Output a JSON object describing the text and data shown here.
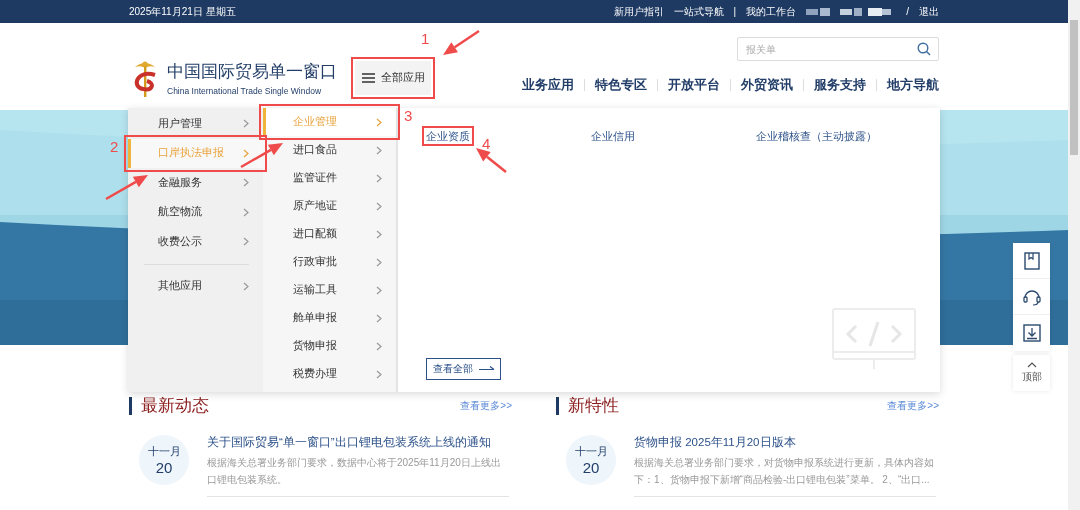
{
  "top_bar": {
    "date": "2025年11月21日 星期五",
    "links": [
      {
        "kind": "link",
        "text": "新用户指引"
      },
      {
        "kind": "link",
        "text": "一站式导航"
      },
      {
        "kind": "separator",
        "text": "|"
      },
      {
        "kind": "link",
        "text": "我的工作台"
      },
      {
        "kind": "masked"
      },
      {
        "kind": "separator",
        "text": "/"
      },
      {
        "kind": "link",
        "text": "退出"
      }
    ]
  },
  "header": {
    "logo_title": "中国国际贸易单一窗口",
    "logo_subtitle": "China International Trade Single Window",
    "all_apps_button": {
      "label": "全部应用",
      "annotation": "1"
    },
    "search": {
      "placeholder": "报关单"
    },
    "nav": [
      "业务应用",
      "特色专区",
      "开放平台",
      "外贸资讯",
      "服务支持",
      "地方导航"
    ]
  },
  "app_menu": {
    "category_groups": [
      [
        {
          "label": "用户管理",
          "selected": false
        },
        {
          "label": "口岸执法申报",
          "selected": true,
          "annotation": "2"
        },
        {
          "label": "金融服务",
          "selected": false
        },
        {
          "label": "航空物流",
          "selected": false
        },
        {
          "label": "收费公示",
          "selected": false
        }
      ],
      [
        {
          "label": "其他应用",
          "selected": false
        }
      ]
    ],
    "subcategories": [
      {
        "label": "企业管理",
        "selected": true,
        "annotation": "3"
      },
      {
        "label": "进口食品",
        "selected": false
      },
      {
        "label": "监管证件",
        "selected": false
      },
      {
        "label": "原产地证",
        "selected": false
      },
      {
        "label": "进口配额",
        "selected": false
      },
      {
        "label": "行政审批",
        "selected": false
      },
      {
        "label": "运输工具",
        "selected": false
      },
      {
        "label": "舱单申报",
        "selected": false
      },
      {
        "label": "货物申报",
        "selected": false
      },
      {
        "label": "税费办理",
        "selected": false
      }
    ],
    "items": [
      {
        "label": "企业资质",
        "annotation": "4"
      },
      {
        "label": "企业信用"
      },
      {
        "label": "企业稽核查（主动披露）"
      }
    ],
    "view_all": "查看全部"
  },
  "sections": [
    {
      "title": "最新动态",
      "more": "查看更多>>",
      "items": [
        {
          "month": "十一月",
          "day": "20",
          "title": "关于国际贸易“单一窗口”出口锂电包装系统上线的通知",
          "summary": "根据海关总署业务部门要求，数据中心将于2025年11月20日上线出口锂电包装系统。"
        }
      ]
    },
    {
      "title": "新特性",
      "more": "查看更多>>",
      "items": [
        {
          "month": "十一月",
          "day": "20",
          "title": "货物申报 2025年11月20日版本",
          "summary": "根据海关总署业务部门要求，对货物申报系统进行更新，具体内容如下：1、货物申报下新增“商品检验-出口锂电包装”菜单。 2、“出口..."
        }
      ]
    }
  ],
  "side_toolbar": {
    "top_label": "顶部"
  }
}
